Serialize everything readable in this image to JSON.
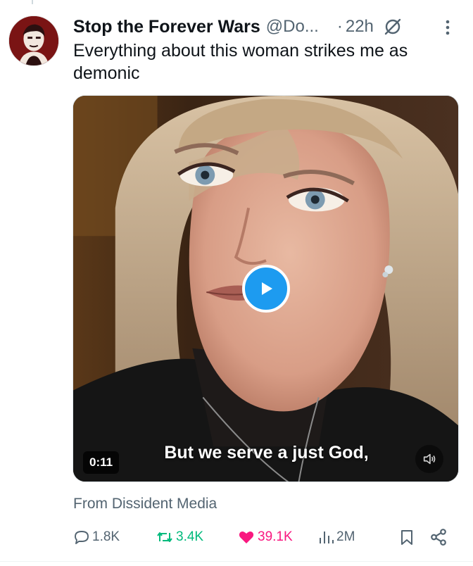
{
  "tweet": {
    "display_name": "Stop the Forever Wars",
    "handle": "@Do...",
    "separator": "·",
    "time": "22h",
    "text": "Everything about this woman strikes me as demonic",
    "source": "From Dissident Media"
  },
  "media": {
    "duration": "0:11",
    "caption": "But we serve a just God,"
  },
  "actions": {
    "replies": "1.8K",
    "retweets": "3.4K",
    "likes": "39.1K",
    "views": "2M"
  },
  "colors": {
    "text": "#0f1419",
    "secondary": "#536471",
    "accent_blue": "#1d9bf0",
    "retweet_green": "#00ba7c",
    "like_pink": "#f91880"
  },
  "icons": [
    "grok-icon",
    "more-icon",
    "play-icon",
    "mute-icon",
    "reply-icon",
    "retweet-icon",
    "heart-icon",
    "views-icon",
    "bookmark-icon",
    "share-icon"
  ]
}
